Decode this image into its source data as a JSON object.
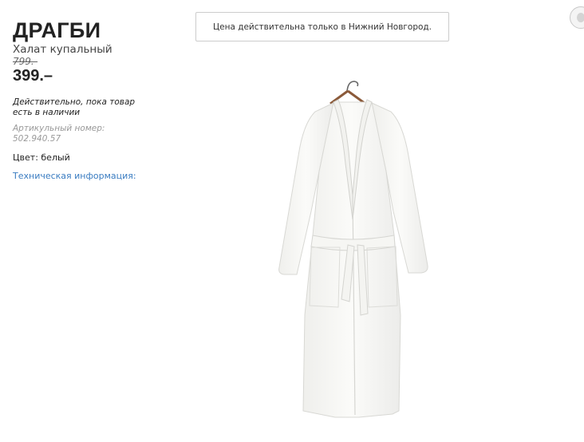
{
  "product": {
    "name": "ДРАГБИ",
    "type": "Халат купальный",
    "old_price": "799.-",
    "price": "399.–",
    "validity": "Действительно, пока товар есть в наличии",
    "article_label": "Артикульный номер:",
    "article_number": "502.940.57",
    "color": "Цвет: белый",
    "tech_link": "Техническая информация:"
  },
  "notice": {
    "text": "Цена действительна только в Нижний Новгород."
  },
  "image": {
    "subject": "white-bathrobe-on-hanger",
    "color": "#f8f8f6"
  },
  "colors": {
    "link": "#3a7cc1",
    "text": "#222222",
    "muted": "#999999"
  }
}
